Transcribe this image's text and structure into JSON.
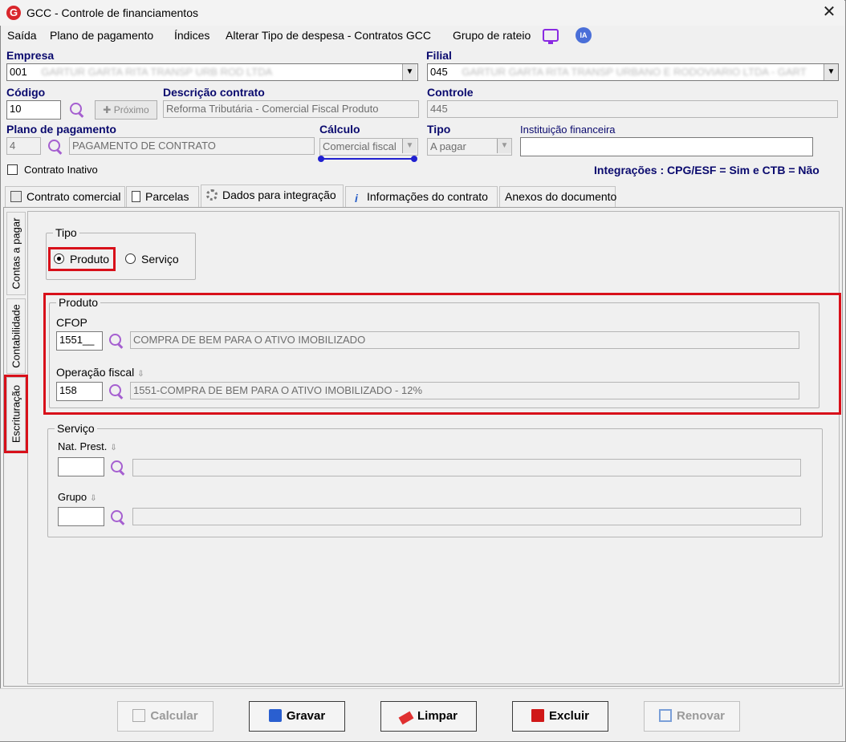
{
  "window": {
    "title": "GCC - Controle de financiamentos",
    "close_glyph": "✕"
  },
  "menu": {
    "items": [
      "Saída",
      "Plano de pagamento",
      "Índices",
      "Alterar Tipo de despesa - Contratos GCC",
      "Grupo de rateio"
    ],
    "ia_label": "IA"
  },
  "header": {
    "empresa_label": "Empresa",
    "empresa_value": "001",
    "empresa_name": "GARTUR GARTA RITA TRANSP URB ROD LTDA",
    "filial_label": "Filial",
    "filial_value": "045",
    "filial_name": "GARTUR GARTA RITA TRANSP URBANO E RODOVIARIO LTDA - GART",
    "codigo_label": "Código",
    "codigo_value": "10",
    "proximo_label": "Próximo",
    "descricao_label": "Descrição contrato",
    "descricao_value": "Reforma Tributária - Comercial Fiscal Produto",
    "controle_label": "Controle",
    "controle_value": "445",
    "plano_label": "Plano de pagamento",
    "plano_value": "4",
    "plano_desc": "PAGAMENTO DE CONTRATO",
    "calculo_label": "Cálculo",
    "calculo_value": "Comercial fiscal",
    "tipo_label": "Tipo",
    "tipo_value": "A pagar",
    "instituicao_label": "Instituição financeira",
    "instituicao_value": "",
    "contrato_inativo_label": "Contrato Inativo",
    "integracoes": "Integrações : CPG/ESF = Sim e CTB = Não"
  },
  "tabs": [
    {
      "label": "Contrato comercial",
      "icon": "calculator-icon"
    },
    {
      "label": "Parcelas",
      "icon": "document-icon"
    },
    {
      "label": "Dados para integração",
      "icon": "gear-icon"
    },
    {
      "label": "Informações do contrato",
      "icon": "info-icon"
    },
    {
      "label": "Anexos do documento",
      "icon": ""
    }
  ],
  "side_tabs": [
    "Contas a pagar",
    "Contabilidade",
    "Escrituração"
  ],
  "tipo_group": {
    "title": "Tipo",
    "produto": "Produto",
    "servico": "Serviço",
    "selected": "Produto"
  },
  "produto_group": {
    "title": "Produto",
    "cfop_label": "CFOP",
    "cfop_value": "1551__",
    "cfop_desc": "COMPRA DE BEM PARA O ATIVO IMOBILIZADO",
    "op_label": "Operação fiscal",
    "op_value": "158",
    "op_desc": "1551-COMPRA DE BEM PARA O ATIVO IMOBILIZADO - 12%"
  },
  "servico_group": {
    "title": "Serviço",
    "nat_label": "Nat. Prest.",
    "nat_value": "",
    "grupo_label": "Grupo",
    "grupo_value": ""
  },
  "buttons": {
    "calcular": "Calcular",
    "gravar": "Gravar",
    "limpar": "Limpar",
    "excluir": "Excluir",
    "renovar": "Renovar"
  },
  "colors": {
    "highlight_red": "#d8101a",
    "label_blue": "#0a0a6e",
    "search_purple": "#a55fd0"
  }
}
